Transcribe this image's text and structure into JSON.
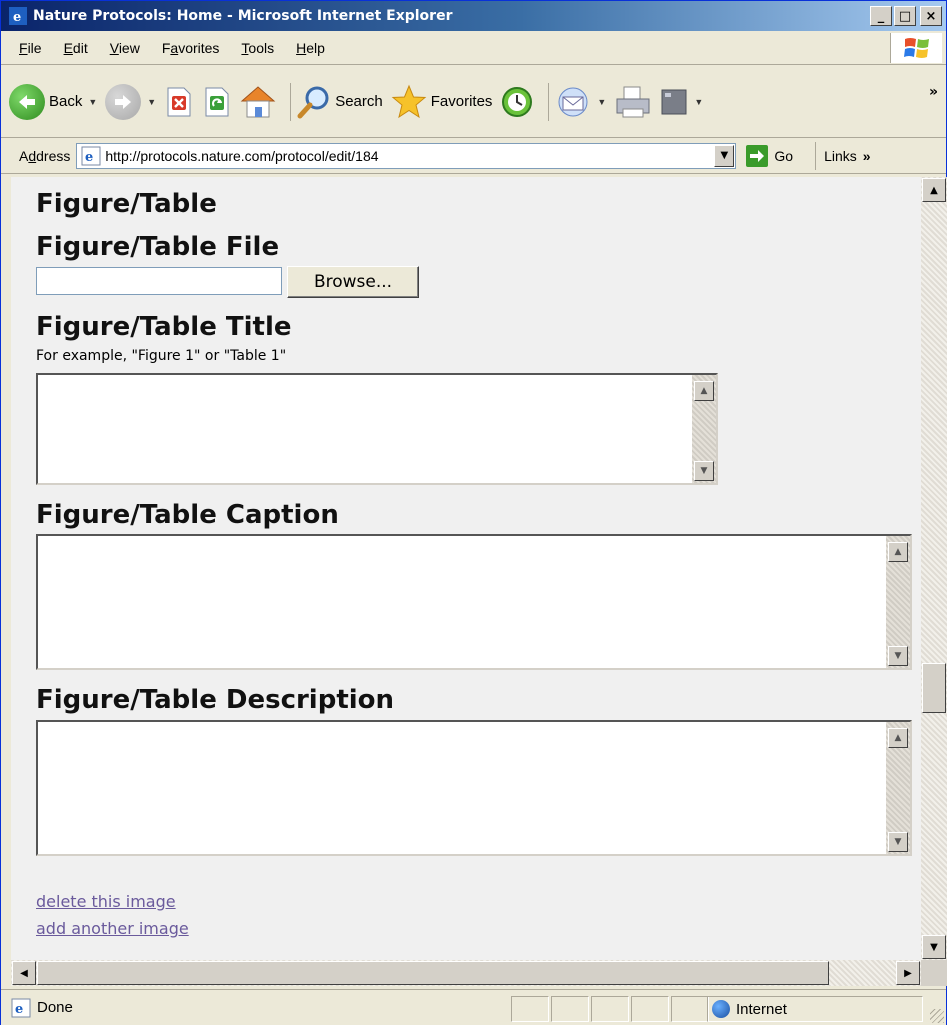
{
  "window": {
    "title": "Nature Protocols: Home - Microsoft Internet Explorer",
    "minimize_label": "_",
    "maximize_label": "□",
    "close_label": "×"
  },
  "menubar": {
    "items": [
      {
        "acc": "F",
        "rest": "ile"
      },
      {
        "acc": "E",
        "rest": "dit"
      },
      {
        "acc": "V",
        "rest": "iew"
      },
      {
        "pre": "F",
        "acc": "a",
        "rest": "vorites"
      },
      {
        "acc": "T",
        "rest": "ools"
      },
      {
        "acc": "H",
        "rest": "elp"
      }
    ]
  },
  "toolbar": {
    "back_label": "Back",
    "search_label": "Search",
    "favorites_label": "Favorites",
    "more_label": "»"
  },
  "addressbar": {
    "label_pre": "A",
    "label_acc": "d",
    "label_rest": "dress",
    "url": "http://protocols.nature.com/protocol/edit/184",
    "go_label": "Go",
    "links_label": "Links",
    "links_more": "»"
  },
  "page": {
    "section_heading": "Figure/Table",
    "file_heading": "Figure/Table File",
    "browse_label": "Browse...",
    "title_heading": "Figure/Table Title",
    "title_hint": "For example, \"Figure 1\" or \"Table 1\"",
    "caption_heading": "Figure/Table Caption",
    "description_heading": "Figure/Table Description",
    "delete_link": "delete this image",
    "add_link": "add another image"
  },
  "statusbar": {
    "status_text": "Done",
    "zone_text": "Internet"
  },
  "colors": {
    "titlebar_start": "#0a246a",
    "link": "#6a5a9c",
    "content_bg": "#f0f0f0"
  }
}
